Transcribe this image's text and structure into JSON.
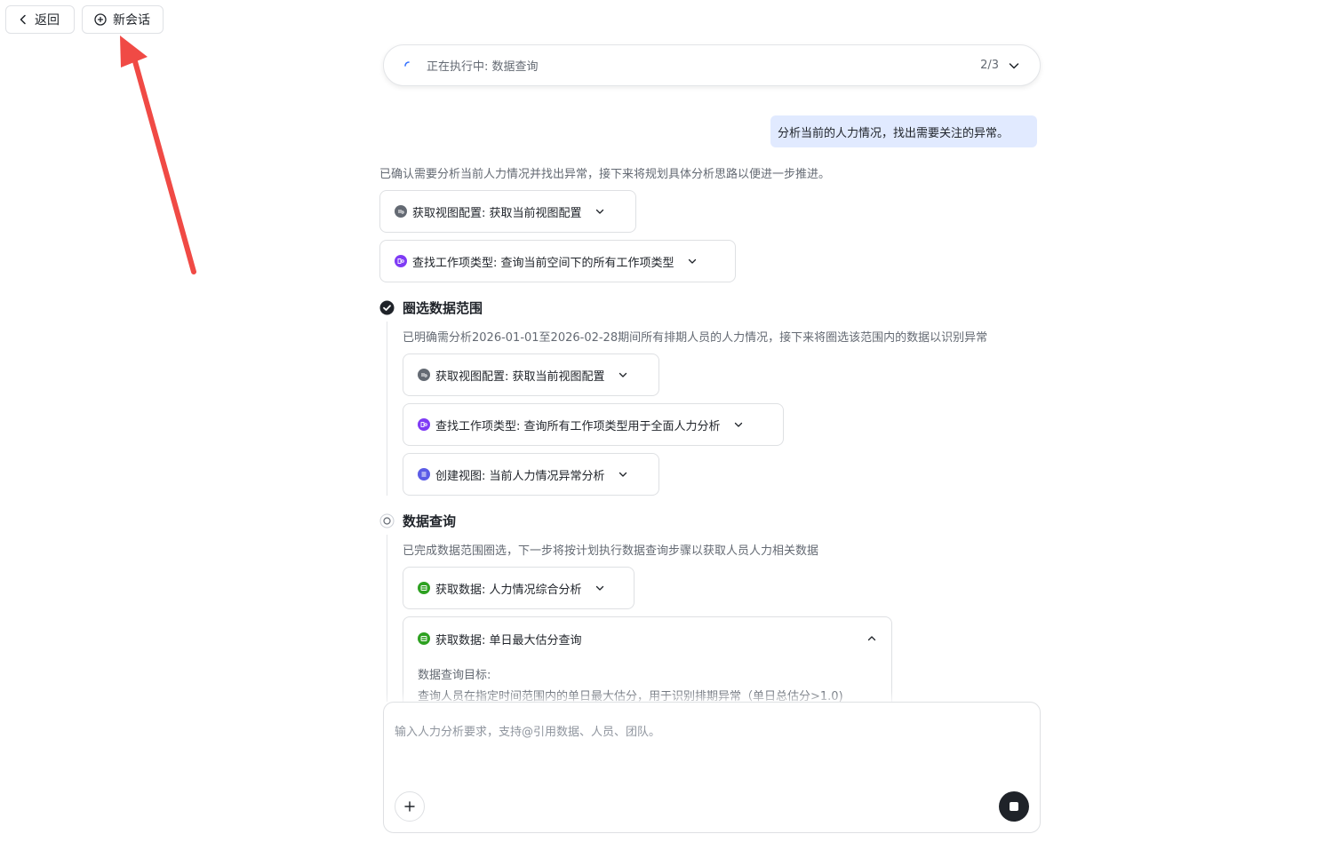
{
  "top_bar": {
    "back_label": "返回",
    "new_chat_label": "新会话"
  },
  "status": {
    "text": "正在执行中: 数据查询",
    "progress": "2/3"
  },
  "user_message": "分析当前的人力情况，找出需要关注的异常。",
  "intro_text": "已确认需要分析当前人力情况并找出异常，接下来将规划具体分析思路以便进一步推进。",
  "intro_tools": [
    {
      "label": "获取视图配置: 获取当前视图配置",
      "icon": "view-config-icon",
      "color": "#646a73"
    },
    {
      "label": "查找工作项类型: 查询当前空间下的所有工作项类型",
      "icon": "work-item-type-icon",
      "color": "#7f3bf5"
    }
  ],
  "steps": [
    {
      "title": "圈选数据范围",
      "state": "done",
      "description": "已明确需分析2026-01-01至2026-02-28期间所有排期人员的人力情况，接下来将圈选该范围内的数据以识别异常",
      "tools": [
        {
          "label": "获取视图配置: 获取当前视图配置",
          "icon": "view-config-icon",
          "color": "#646a73"
        },
        {
          "label": "查找工作项类型: 查询所有工作项类型用于全面人力分析",
          "icon": "work-item-type-icon",
          "color": "#7f3bf5"
        },
        {
          "label": "创建视图: 当前人力情况异常分析",
          "icon": "create-view-icon",
          "color": "#5b5ce6"
        }
      ]
    },
    {
      "title": "数据查询",
      "state": "running",
      "description": "已完成数据范围圈选，下一步将按计划执行数据查询步骤以获取人员人力相关数据",
      "tools": [
        {
          "label": "获取数据: 人力情况综合分析",
          "icon": "data-fetch-icon",
          "color": "#2ea121"
        },
        {
          "label": "获取数据: 单日最大估分查询",
          "icon": "data-fetch-icon",
          "color": "#2ea121",
          "expanded": true,
          "detail_title": "数据查询目标:",
          "detail_text": "查询人员在指定时间范围内的单日最大估分，用于识别排期异常（单日总估分>1.0)"
        }
      ]
    }
  ],
  "input": {
    "placeholder": "输入人力分析要求，支持@引用数据、人员、团队。"
  },
  "colors": {
    "annotation_arrow": "#f04a45",
    "user_bubble": "#e1eaff",
    "accent": "#3370ff"
  }
}
